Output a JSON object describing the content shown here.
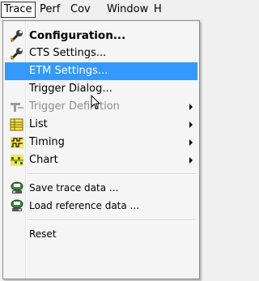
{
  "menubar": {
    "items": [
      {
        "label": "Trace"
      },
      {
        "label": "Perf"
      },
      {
        "label": "Cov"
      },
      {
        "label": "Window"
      },
      {
        "label": "H"
      }
    ]
  },
  "trace_menu": {
    "items": [
      {
        "label": "Configuration...",
        "icon": "wrench-icon",
        "style": "bold"
      },
      {
        "label": "CTS Settings...",
        "icon": "wrench-icon"
      },
      {
        "label": "ETM Settings...",
        "state": "highlighted"
      },
      {
        "label": "Trigger Dialog..."
      },
      {
        "label": "Trigger Definition",
        "icon": "trigger-icon",
        "state": "disabled",
        "submenu": true
      },
      {
        "label": "List",
        "icon": "list-icon",
        "submenu": true
      },
      {
        "label": "Timing",
        "icon": "timing-icon",
        "submenu": true
      },
      {
        "label": "Chart",
        "icon": "chart-icon",
        "submenu": true
      },
      {
        "label": "Save trace data ...",
        "icon": "save-trace-icon"
      },
      {
        "label": "Load reference data ...",
        "icon": "load-reference-icon"
      },
      {
        "label": "Reset"
      }
    ]
  },
  "colors": {
    "highlight": "#3399ff",
    "disabled_text": "#8c8c8c"
  }
}
